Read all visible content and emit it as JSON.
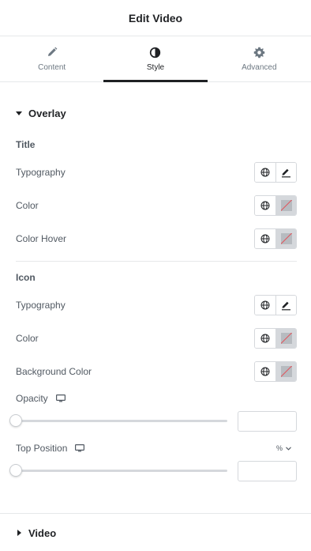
{
  "header": {
    "title": "Edit Video"
  },
  "tabs": [
    {
      "label": "Content",
      "icon": "pencil-icon"
    },
    {
      "label": "Style",
      "icon": "contrast-icon",
      "active": true
    },
    {
      "label": "Advanced",
      "icon": "gear-icon"
    }
  ],
  "sections": {
    "overlay": {
      "label": "Overlay",
      "expanded": true
    },
    "video": {
      "label": "Video",
      "expanded": false
    }
  },
  "title_group": {
    "heading": "Title",
    "typography_label": "Typography",
    "color_label": "Color",
    "color_hover_label": "Color Hover"
  },
  "icon_group": {
    "heading": "Icon",
    "typography_label": "Typography",
    "color_label": "Color",
    "background_color_label": "Background Color",
    "opacity_label": "Opacity",
    "opacity_value": "",
    "top_position_label": "Top Position",
    "top_position_unit": "%",
    "top_position_value": ""
  },
  "colors": {
    "accent": "#1f2124",
    "text": "#515962",
    "border": "#d5d8dc",
    "no_color_slash": "#e2545b"
  }
}
